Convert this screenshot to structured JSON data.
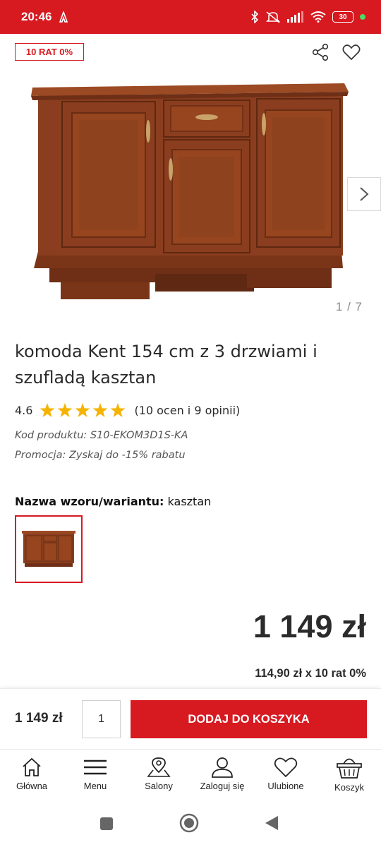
{
  "status_bar": {
    "time": "20:46",
    "battery": "30"
  },
  "header": {
    "badge": "10 RAT 0%",
    "share_icon": "share-icon",
    "favorite_icon": "heart-icon"
  },
  "gallery": {
    "counter": "1 / 7",
    "next_icon": "chevron-right-icon"
  },
  "product": {
    "title": "komoda Kent 154 cm z 3 drzwiami i szufladą kasztan",
    "rating": "4.6",
    "rating_value": 4.6,
    "rating_max": 5,
    "reviews": "(10 ocen i 9 opinii)",
    "code": "Kod produktu: S10-EKOM3D1S-KA",
    "promo": "Promocja: Zyskaj do -15% rabatu"
  },
  "variant": {
    "label": "Nazwa wzoru/wariantu:",
    "value": "kasztan"
  },
  "pricing": {
    "price": "1 149 zł",
    "installments": "114,90 zł x 10 rat 0%"
  },
  "buy_bar": {
    "price": "1 149 zł",
    "quantity": "1",
    "add_to_cart": "DODAJ DO KOSZYKA"
  },
  "bottom_nav": [
    {
      "label": "Główna",
      "icon": "home-icon"
    },
    {
      "label": "Menu",
      "icon": "menu-icon"
    },
    {
      "label": "Salony",
      "icon": "map-pin-icon"
    },
    {
      "label": "Zaloguj się",
      "icon": "user-icon"
    },
    {
      "label": "Ulubione",
      "icon": "heart-icon"
    },
    {
      "label": "Koszyk",
      "icon": "basket-icon"
    }
  ],
  "colors": {
    "brand_red": "#d71920",
    "star_yellow": "#f5b301",
    "wood": "#8a3e1f"
  }
}
